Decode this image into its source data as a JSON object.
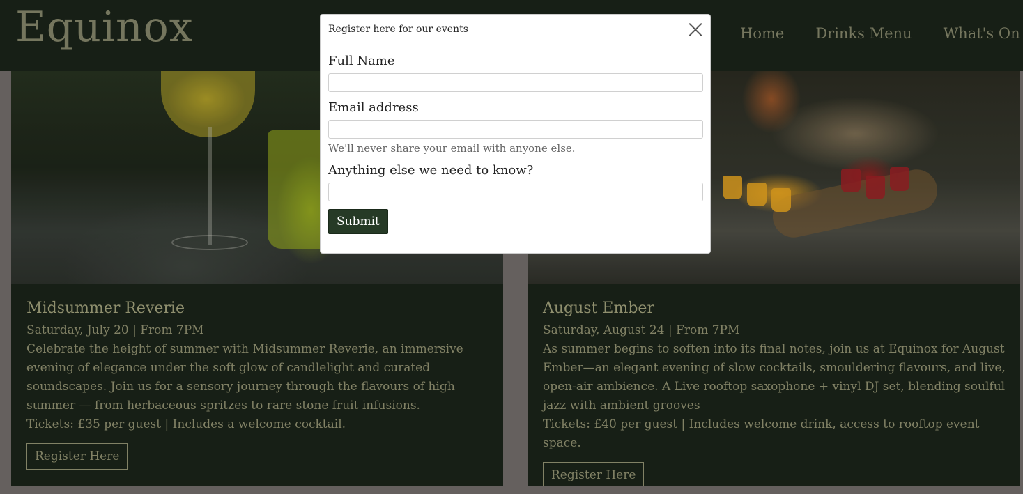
{
  "header": {
    "brand": "Equinox",
    "nav": [
      "Home",
      "Drinks Menu",
      "What's On"
    ]
  },
  "events": [
    {
      "title": "Midsummer Reverie",
      "date": "Saturday, July 20 | From 7PM",
      "description": "Celebrate the height of summer with Midsummer Reverie, an immersive evening of elegance under the soft glow of candlelight and curated soundscapes. Join us for a sensory journey through the flavours of high summer — from herbaceous spritzes to rare stone fruit infusions.",
      "tickets": "Tickets: £35 per guest | Includes a welcome cocktail.",
      "button": "Register Here"
    },
    {
      "title": "August Ember",
      "date": "Saturday, August 24 | From 7PM",
      "description": "As summer begins to soften into its final notes, join us at Equinox for August Ember—an elegant evening of slow cocktails, smouldering flavours, and live, open-air ambience. A Live rooftop saxophone + vinyl DJ set, blending soulful jazz with ambient grooves",
      "tickets": "Tickets: £40 per guest | Includes welcome drink, access to rooftop event space.",
      "button": "Register Here"
    }
  ],
  "modal": {
    "title": "Register here for our events",
    "full_name_label": "Full Name",
    "full_name_value": "",
    "email_label": "Email address",
    "email_value": "",
    "email_help": "We'll never share your email with anyone else.",
    "notes_label": "Anything else we need to know?",
    "notes_value": "",
    "submit": "Submit"
  },
  "colors": {
    "header_bg": "#1a2218",
    "brand_text": "#7f8067",
    "card_bg": "#1a2218",
    "card_title": "#9c9c78",
    "card_text": "#8d8d6e",
    "submit_bg": "#263a26",
    "page_bg": "#6e6966"
  },
  "icons": {
    "modal_close": "close-icon"
  }
}
